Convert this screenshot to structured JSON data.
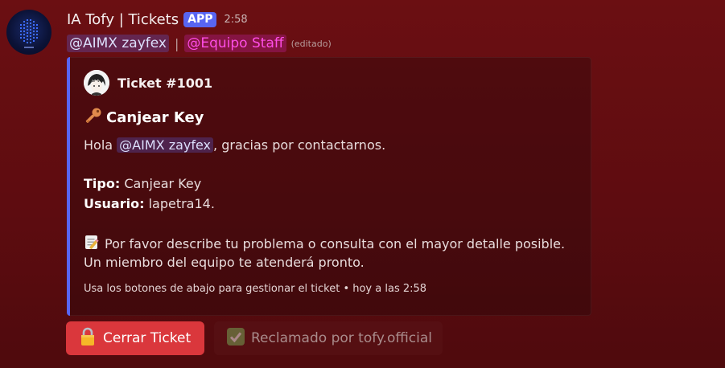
{
  "message": {
    "author": "IA Tofy | Tickets",
    "badge": "APP",
    "time": "2:58",
    "mention_user": "@AIMX zayfex",
    "separator": "|",
    "mention_role": "@Equipo Staff",
    "edited": "(editado)"
  },
  "embed": {
    "accent_color": "#5865f2",
    "author_name": "Ticket #1001",
    "title_icon": "key-icon",
    "title": "Canjear Key",
    "greeting_prefix": "Hola",
    "greeting_mention": "@AIMX zayfex",
    "greeting_suffix": ", gracias por contactarnos.",
    "tipo_label": "Tipo:",
    "tipo_value": "Canjear Key",
    "usuario_label": "Usuario:",
    "usuario_value": "lapetra14.",
    "note_icon": "memo-icon",
    "instructions_line1": "Por favor describe tu problema o consulta con el mayor detalle posible.",
    "instructions_line2": "Un miembro del equipo te atenderá pronto.",
    "footer": "Usa los botones de abajo para gestionar el ticket • hoy a las 2:58"
  },
  "buttons": {
    "close": {
      "icon": "lock-icon",
      "label": "Cerrar Ticket",
      "color": "#da373c"
    },
    "claimed": {
      "icon": "check-icon",
      "label": "Reclamado por tofy.official"
    }
  }
}
